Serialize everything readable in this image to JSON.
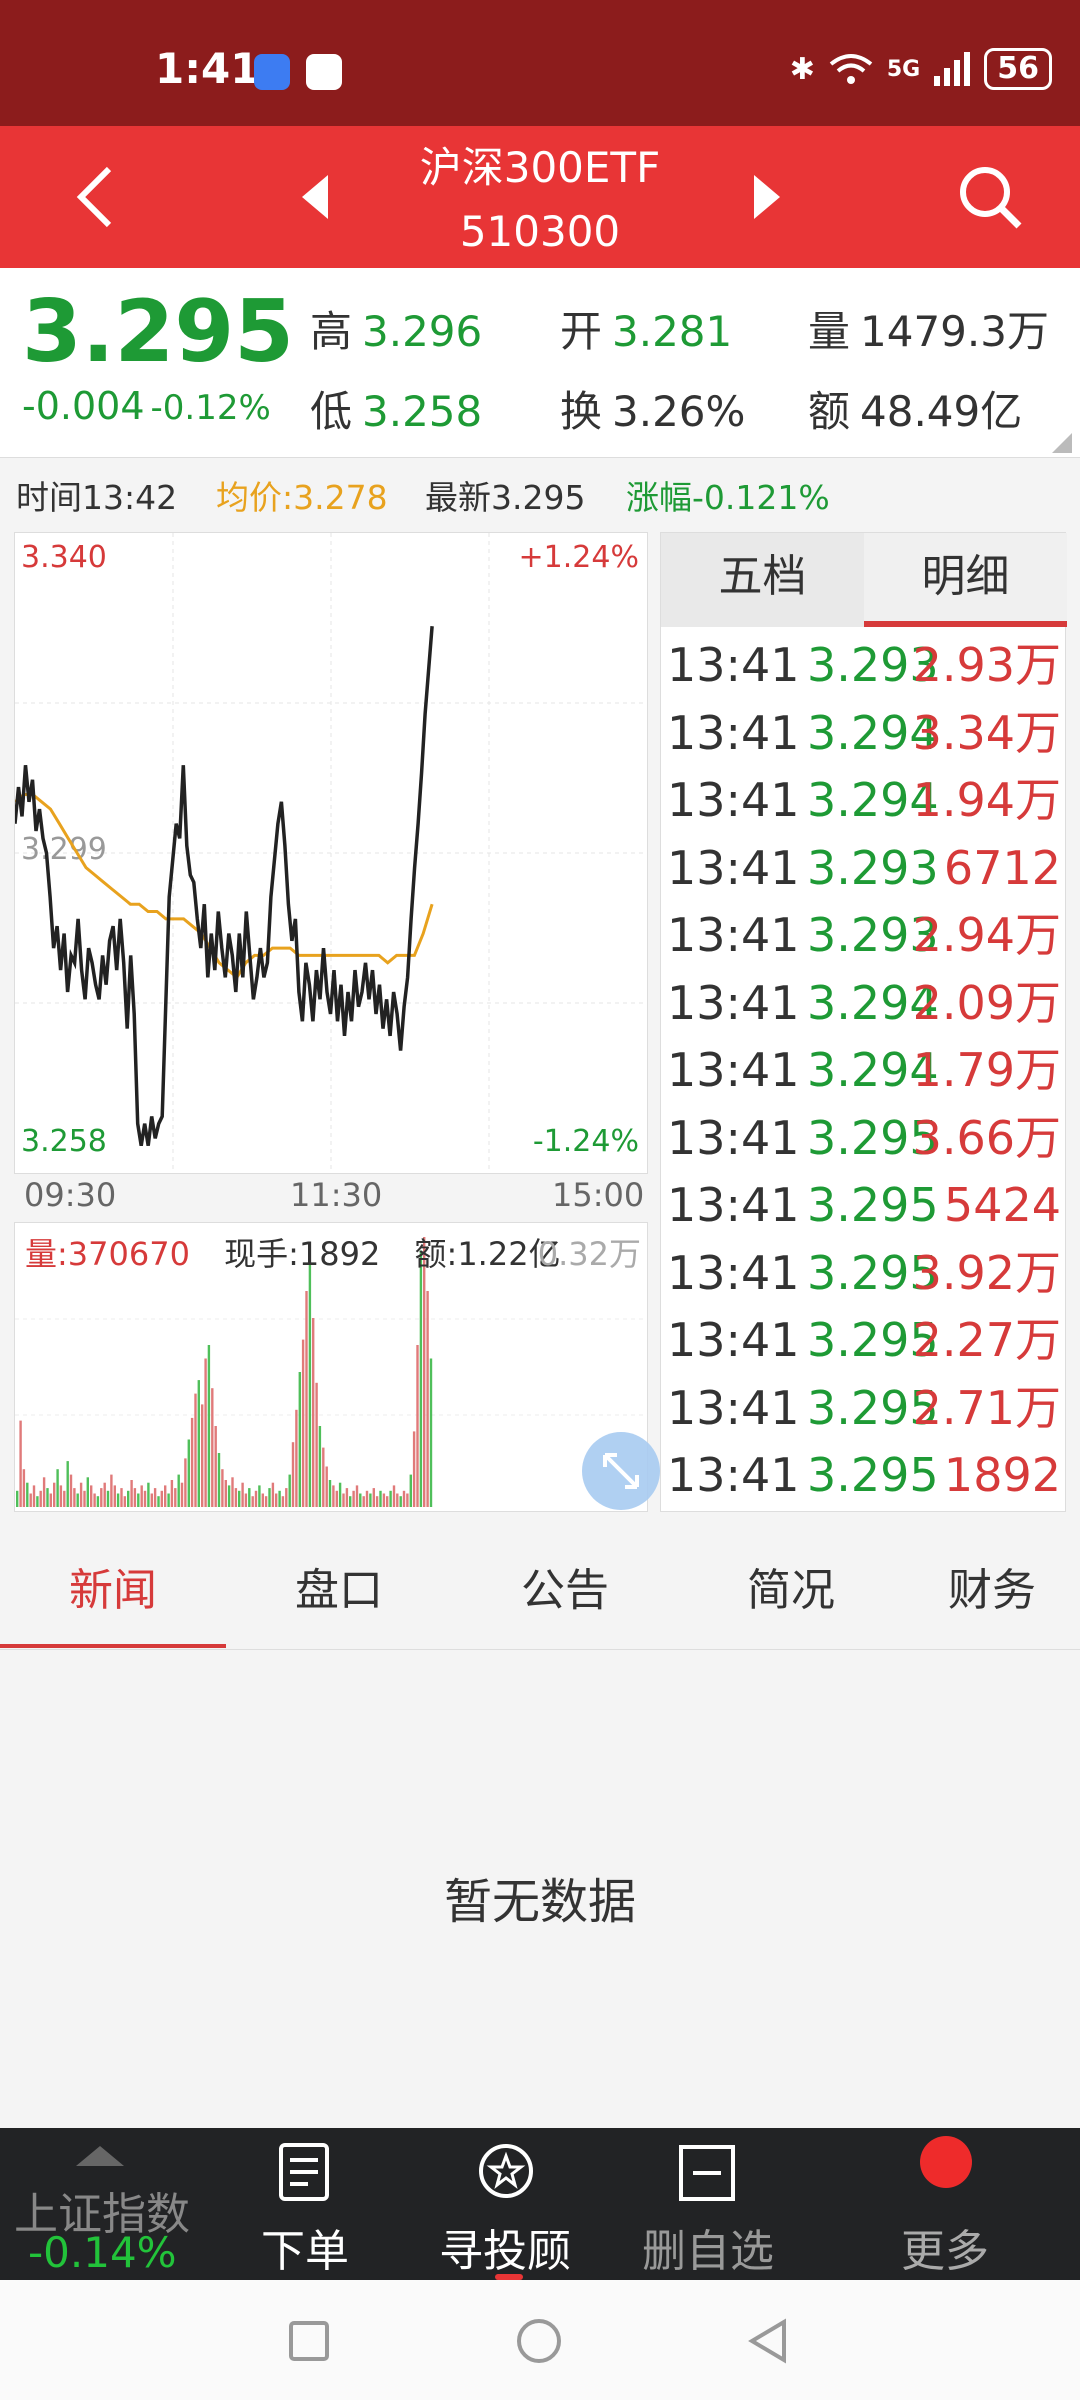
{
  "status_bar": {
    "time": "1:41",
    "network": "5G",
    "battery": "56"
  },
  "header": {
    "title": "沪深300ETF",
    "code": "510300"
  },
  "quote": {
    "price": "3.295",
    "change": "-0.004",
    "change_pct": "-0.12%",
    "high_label": "高",
    "high": "3.296",
    "open_label": "开",
    "open": "3.281",
    "volume_label": "量",
    "volume": "1479.3万",
    "low_label": "低",
    "low": "3.258",
    "turnover_label": "换",
    "turnover": "3.26%",
    "amount_label": "额",
    "amount": "48.49亿"
  },
  "info_line": {
    "time": "时间13:42",
    "avg": "均价:3.278",
    "latest": "最新3.295",
    "change": "涨幅-0.121%"
  },
  "chart_data": [
    {
      "type": "line",
      "ylim": [
        3.258,
        3.34
      ],
      "y_ticks": [
        "3.340",
        "3.299",
        "3.258"
      ],
      "pct_ticks": [
        "+1.24%",
        "-1.24%"
      ],
      "x_ticks": [
        "09:30",
        "11:30",
        "15:00"
      ],
      "series": [
        {
          "values": [
            3.303,
            3.308,
            3.304,
            3.311,
            3.306,
            3.309,
            3.302,
            3.305,
            3.301,
            3.299,
            3.293,
            3.286,
            3.289,
            3.283,
            3.288,
            3.28,
            3.285,
            3.284,
            3.29,
            3.283,
            3.279,
            3.286,
            3.284,
            3.281,
            3.279,
            3.285,
            3.281,
            3.287,
            3.289,
            3.283,
            3.29,
            3.284,
            3.275,
            3.285,
            3.277,
            3.262,
            3.259,
            3.262,
            3.259,
            3.263,
            3.26,
            3.262,
            3.263,
            3.278,
            3.293,
            3.298,
            3.303,
            3.301,
            3.311,
            3.3,
            3.296,
            3.295,
            3.29,
            3.286,
            3.292,
            3.282,
            3.288,
            3.283,
            3.291,
            3.286,
            3.282,
            3.288,
            3.285,
            3.28,
            3.288,
            3.282,
            3.291,
            3.285,
            3.279,
            3.282,
            3.286,
            3.282,
            3.284,
            3.293,
            3.298,
            3.303,
            3.306,
            3.3,
            3.292,
            3.287,
            3.29,
            3.28,
            3.276,
            3.284,
            3.281,
            3.276,
            3.283,
            3.279,
            3.286,
            3.28,
            3.277,
            3.283,
            3.276,
            3.281,
            3.274,
            3.28,
            3.276,
            3.283,
            3.278,
            3.28,
            3.284,
            3.279,
            3.283,
            3.277,
            3.281,
            3.275,
            3.279,
            3.274,
            3.28,
            3.277,
            3.272,
            3.278,
            3.282,
            3.29,
            3.297,
            3.303,
            3.31,
            3.318,
            3.324,
            3.33
          ]
        },
        {
          "values": [
            3.306,
            3.307,
            3.307,
            3.306,
            3.305,
            3.303,
            3.301,
            3.299,
            3.297,
            3.296,
            3.295,
            3.294,
            3.293,
            3.292,
            3.292,
            3.291,
            3.291,
            3.29,
            3.29,
            3.29,
            3.289,
            3.288,
            3.286,
            3.284,
            3.283,
            3.282,
            3.284,
            3.285,
            3.285,
            3.286,
            3.286,
            3.286,
            3.285,
            3.285,
            3.285,
            3.285,
            3.285,
            3.285,
            3.285,
            3.285,
            3.285,
            3.285,
            3.284,
            3.285,
            3.285,
            3.285,
            3.288,
            3.292
          ]
        }
      ]
    },
    {
      "type": "bar",
      "series": [
        {
          "values": [
            6,
            32,
            14,
            9,
            5,
            8,
            4,
            6,
            11,
            7,
            5,
            9,
            14,
            8,
            6,
            17,
            12,
            7,
            5,
            9,
            6,
            11,
            8,
            5,
            4,
            7,
            9,
            6,
            12,
            8,
            5,
            7,
            4,
            6,
            10,
            7,
            5,
            8,
            6,
            9,
            5,
            7,
            4,
            6,
            8,
            5,
            10,
            7,
            12,
            9,
            18,
            25,
            33,
            42,
            47,
            38,
            55,
            60,
            44,
            30,
            20,
            14,
            10,
            8,
            11,
            7,
            6,
            9,
            5,
            7,
            4,
            6,
            8,
            5,
            4,
            7,
            9,
            5,
            6,
            4,
            7,
            12,
            24,
            36,
            50,
            62,
            80,
            90,
            70,
            46,
            30,
            22,
            15,
            10,
            8,
            6,
            9,
            5,
            7,
            4,
            6,
            8,
            5,
            4,
            6,
            5,
            7,
            4,
            6,
            5,
            4,
            6,
            8,
            5,
            4,
            6,
            5,
            12,
            28,
            60,
            95,
            100,
            80,
            55
          ]
        }
      ]
    }
  ],
  "volume_legend": {
    "volume": "量:370670",
    "current_hand": "现手:1892",
    "amount": "额:1.22亿",
    "right": "0.32万"
  },
  "tick_panel": {
    "tabs": [
      "五档",
      "明细"
    ],
    "rows": [
      [
        "13:41",
        "3.293",
        "2.93万"
      ],
      [
        "13:41",
        "3.294",
        "3.34万"
      ],
      [
        "13:41",
        "3.294",
        "1.94万"
      ],
      [
        "13:41",
        "3.293",
        "6712"
      ],
      [
        "13:41",
        "3.293",
        "2.94万"
      ],
      [
        "13:41",
        "3.294",
        "2.09万"
      ],
      [
        "13:41",
        "3.294",
        "1.79万"
      ],
      [
        "13:41",
        "3.295",
        "3.66万"
      ],
      [
        "13:41",
        "3.295",
        "5424"
      ],
      [
        "13:41",
        "3.295",
        "3.92万"
      ],
      [
        "13:41",
        "3.295",
        "2.27万"
      ],
      [
        "13:41",
        "3.295",
        "2.71万"
      ],
      [
        "13:41",
        "3.295",
        "1892"
      ]
    ]
  },
  "news_tabs": [
    "新闻",
    "盘口",
    "公告",
    "简况",
    "财务"
  ],
  "empty_text": "暂无数据",
  "bottom_bar": {
    "index_name": "上证指数",
    "index_change": "-0.14%",
    "items": [
      "下单",
      "寻投顾",
      "删自选",
      "更多"
    ]
  },
  "colors": {
    "header": "#e83536",
    "status": "#8c1c1c",
    "up": "#d63a3a",
    "down": "#1e9a35",
    "avg_line": "#e8a21e"
  }
}
